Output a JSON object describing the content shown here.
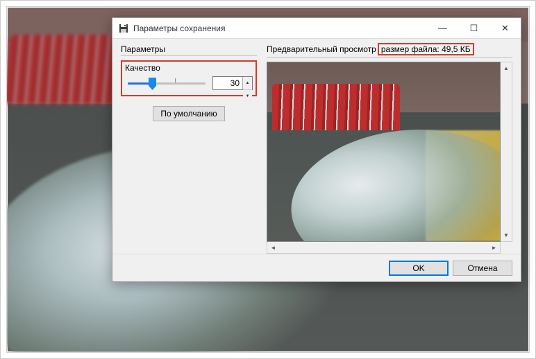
{
  "window": {
    "title": "Параметры сохранения"
  },
  "left": {
    "section_label": "Параметры",
    "quality_label": "Качество",
    "quality_value": "30",
    "default_button": "По умолчанию"
  },
  "right": {
    "preview_label": "Предварительный просмотр",
    "filesize_label": "размер файла: 49,5 КБ"
  },
  "footer": {
    "ok": "OK",
    "cancel": "Отмена"
  },
  "icons": {
    "save": "save-icon",
    "minimize": "—",
    "maximize": "☐",
    "close": "✕",
    "up": "▲",
    "down": "▼",
    "left": "◄",
    "right": "►"
  }
}
